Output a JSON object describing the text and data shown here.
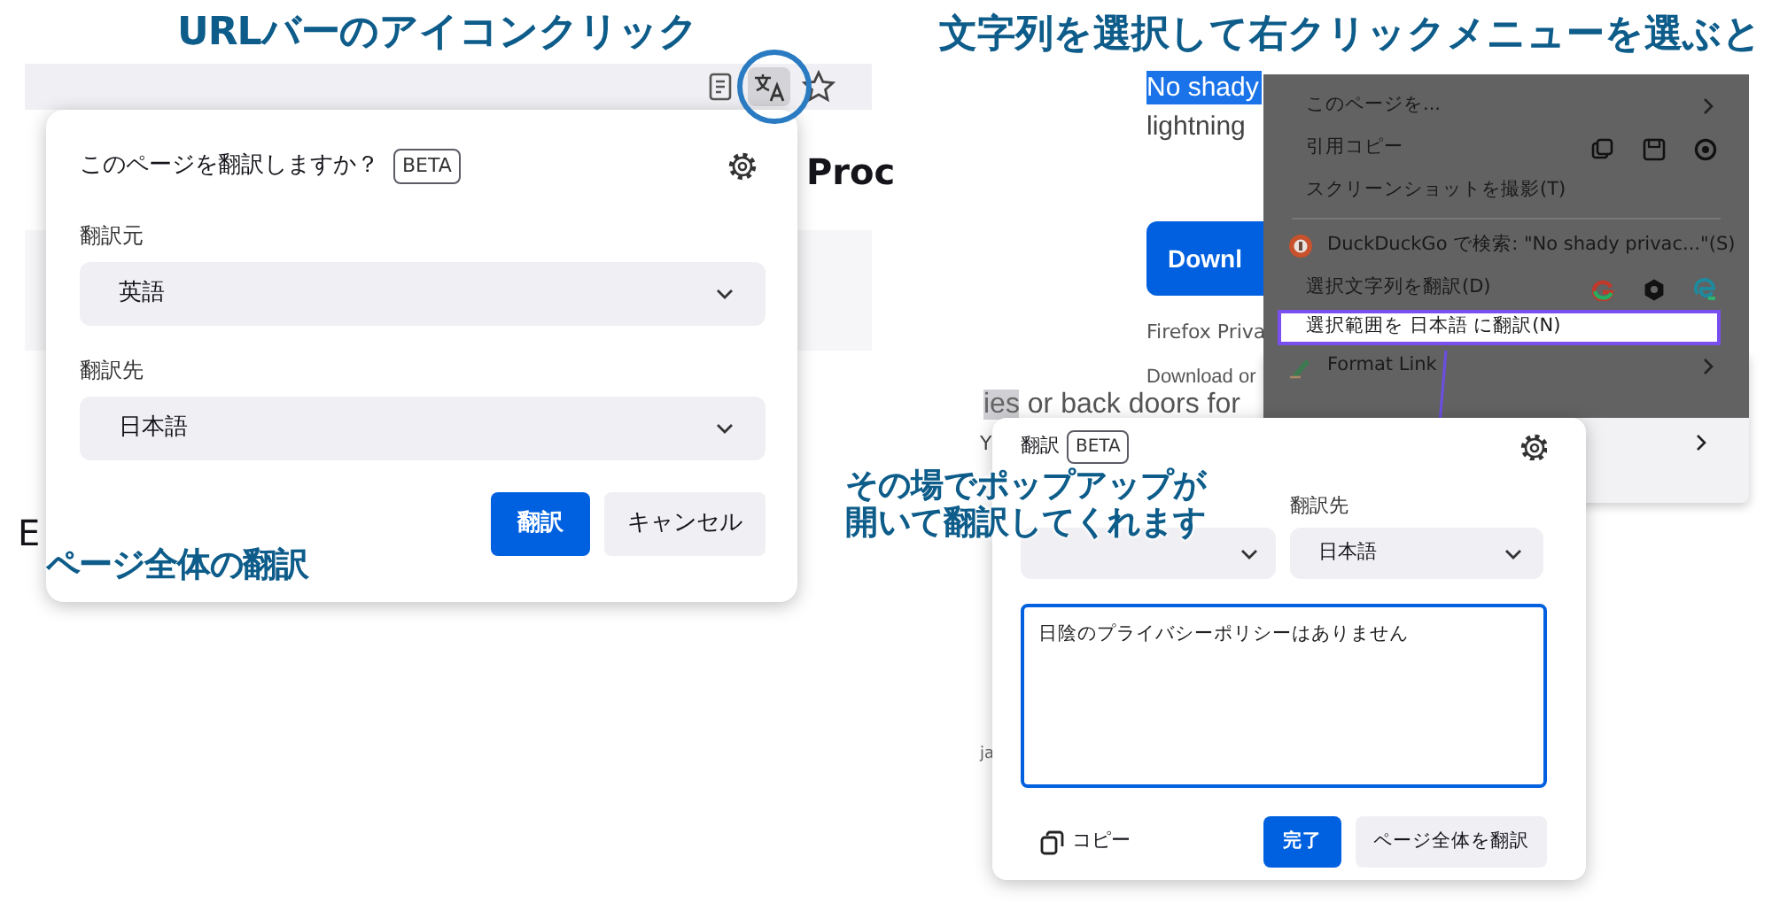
{
  "left_demo": {
    "caption": "URLバーのアイコンクリック",
    "toolbar": {
      "buttons": [
        {
          "kind": "reader",
          "selected": false
        },
        {
          "kind": "translate",
          "selected": true
        },
        {
          "kind": "bookmark",
          "selected": false
        }
      ]
    },
    "page_heading": "Proc",
    "page_fragment": "E",
    "popup": {
      "title": "このページを翻訳しますか？",
      "badge": "BETA",
      "fields": [
        {
          "label": "翻訳元",
          "value": "英語"
        },
        {
          "label": "翻訳先",
          "value": "日本語"
        }
      ],
      "buttons": [
        {
          "label": "翻訳",
          "kind": "primary"
        },
        {
          "label": "キャンセル",
          "kind": "secondary"
        }
      ]
    },
    "bottom_caption": "ページ全体の翻訳"
  },
  "right_demo": {
    "caption": "文字列を選択して右クリックメニューを選ぶと",
    "page": {
      "selected_text": "No shady",
      "second_line": "lightning",
      "download_button": "Downl",
      "note_1": "Firefox Priva",
      "note_2": "Download or"
    },
    "context_menu": {
      "items": [
        {
          "label": "このページを...",
          "kind": "submenu",
          "selected": false
        },
        {
          "label": "引用コピー",
          "kind": "quote",
          "selected": false
        },
        {
          "label": "スクリーンショットを撮影(T)",
          "kind": "plain",
          "selected": false
        },
        {
          "kind": "separator"
        },
        {
          "label": "DuckDuckGo で検索: \"No shady privac...\"(S)",
          "kind": "search",
          "selected": false
        },
        {
          "label": "選択文字列を翻訳(D)",
          "kind": "translate",
          "selected": false
        },
        {
          "label": "選択範囲を 日本語 に翻訳(N)",
          "kind": "plain",
          "selected": true
        },
        {
          "label": "Format Link",
          "kind": "format",
          "selected": false
        }
      ]
    },
    "second_page": {
      "highlighted": "ies",
      "rest": " or back doors for",
      "fragment_1": "Y",
      "fragment_2": "ja"
    },
    "popup": {
      "title": "翻訳",
      "badge": "BETA",
      "target_label": "翻訳先",
      "target_value": "日本語",
      "result": "日陰のプライバシーポリシーはありません",
      "copy": "コピー",
      "buttons": [
        {
          "label": "完了",
          "kind": "primary"
        },
        {
          "label": "ページ全体を翻訳",
          "kind": "secondary"
        }
      ]
    },
    "popup_caption": [
      "その場でポップアップが",
      "開いて翻訳してくれます"
    ]
  }
}
